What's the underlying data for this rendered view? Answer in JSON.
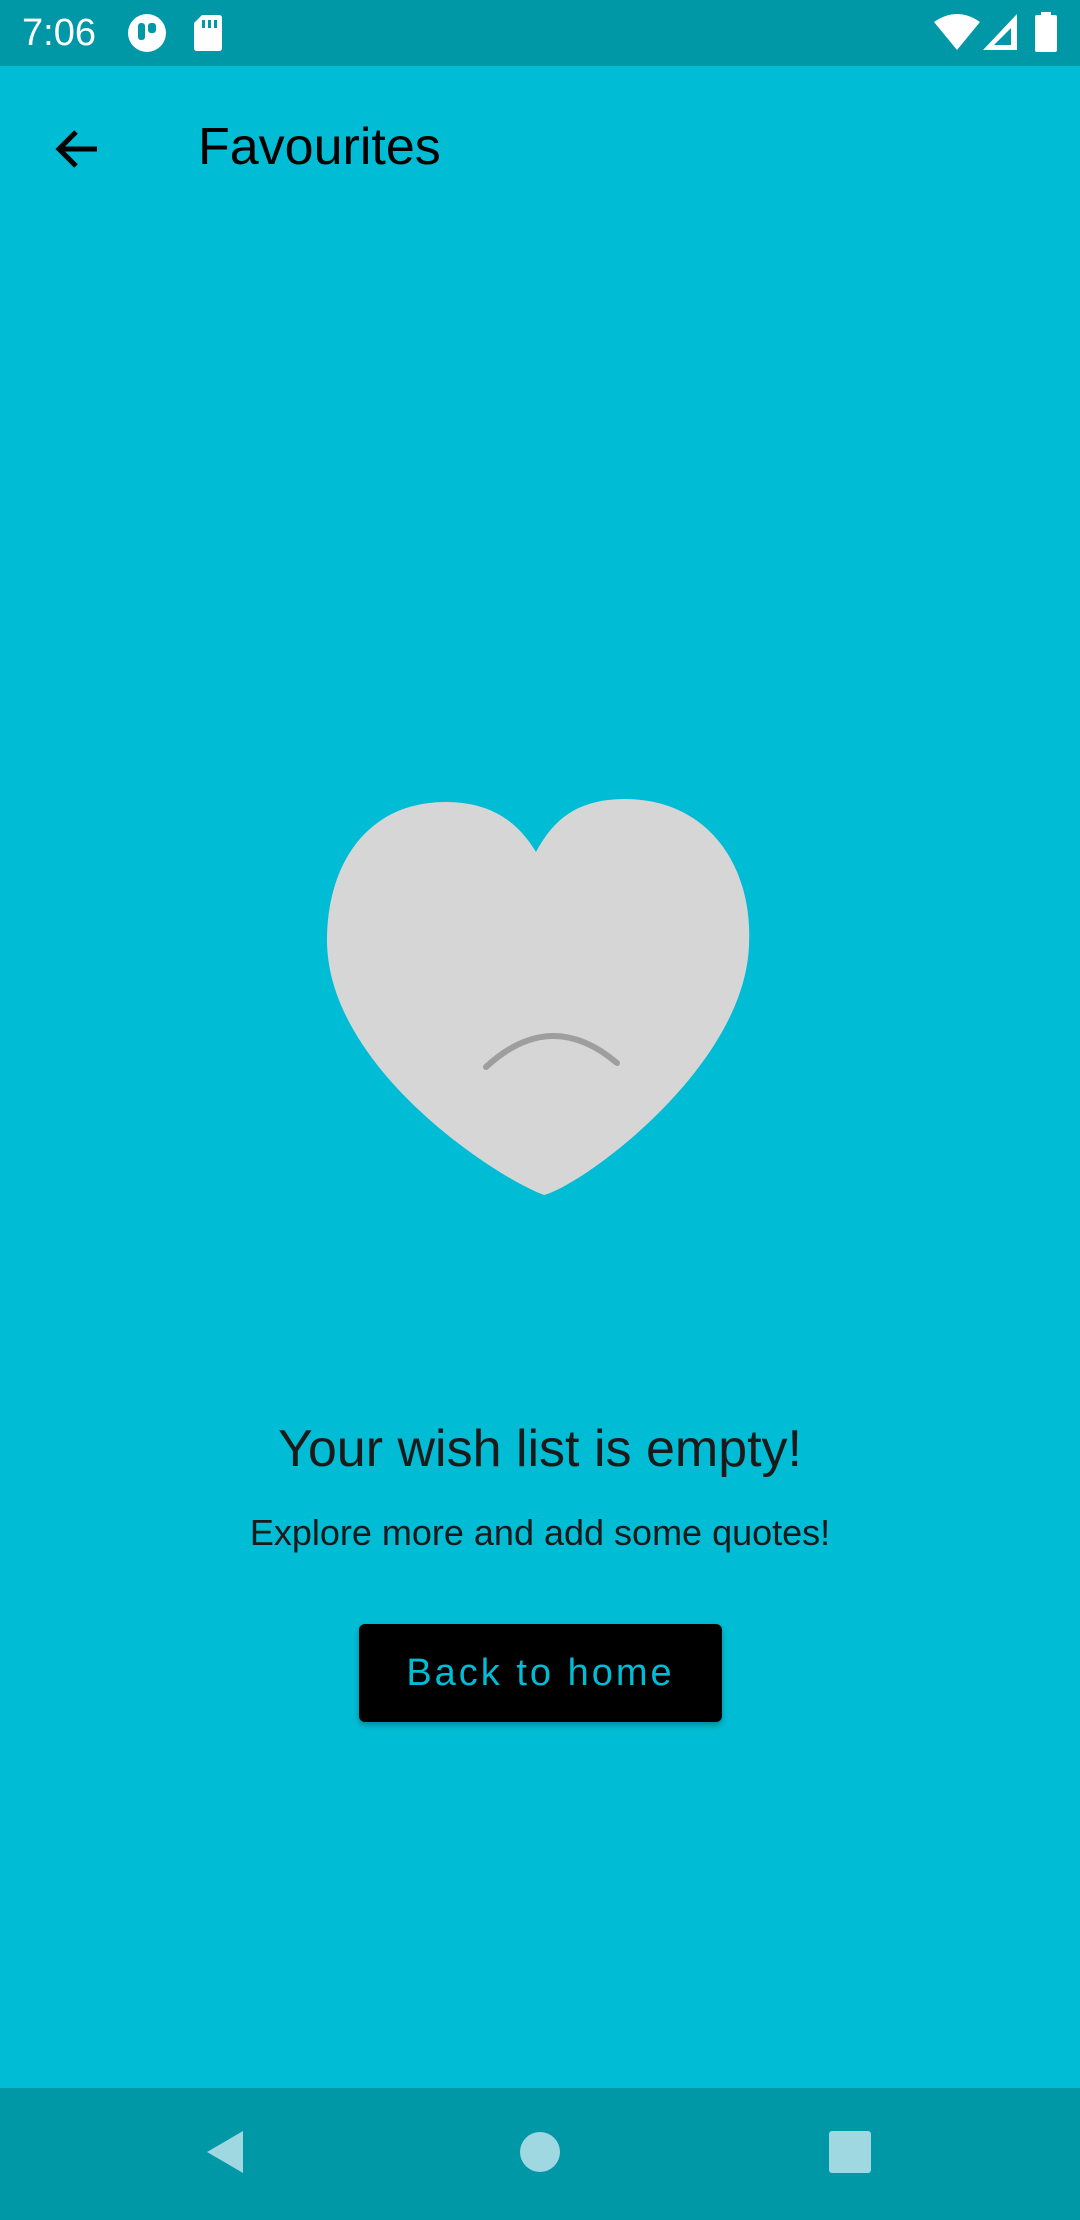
{
  "status_bar": {
    "time": "7:06",
    "left_icons": [
      "app-notification-icon",
      "sd-card-icon"
    ],
    "right_icons": [
      "wifi-icon",
      "cell-signal-icon",
      "battery-icon"
    ]
  },
  "app_bar": {
    "title": "Favourites",
    "back_icon": "arrow-left-icon"
  },
  "empty_state": {
    "illustration": "sad-heart-icon",
    "title": "Your wish list is empty!",
    "subtitle": "Explore more and add some quotes!",
    "button_label": "Back to home"
  },
  "nav_bar": {
    "buttons": [
      "back-triangle-icon",
      "home-circle-icon",
      "recents-square-icon"
    ]
  },
  "colors": {
    "background": "#00bcd4",
    "status_bar": "#0097a7",
    "heart": "#d6d6d6",
    "frown": "#9e9e9e",
    "button_background": "#000000",
    "button_text": "#00bcd4"
  }
}
